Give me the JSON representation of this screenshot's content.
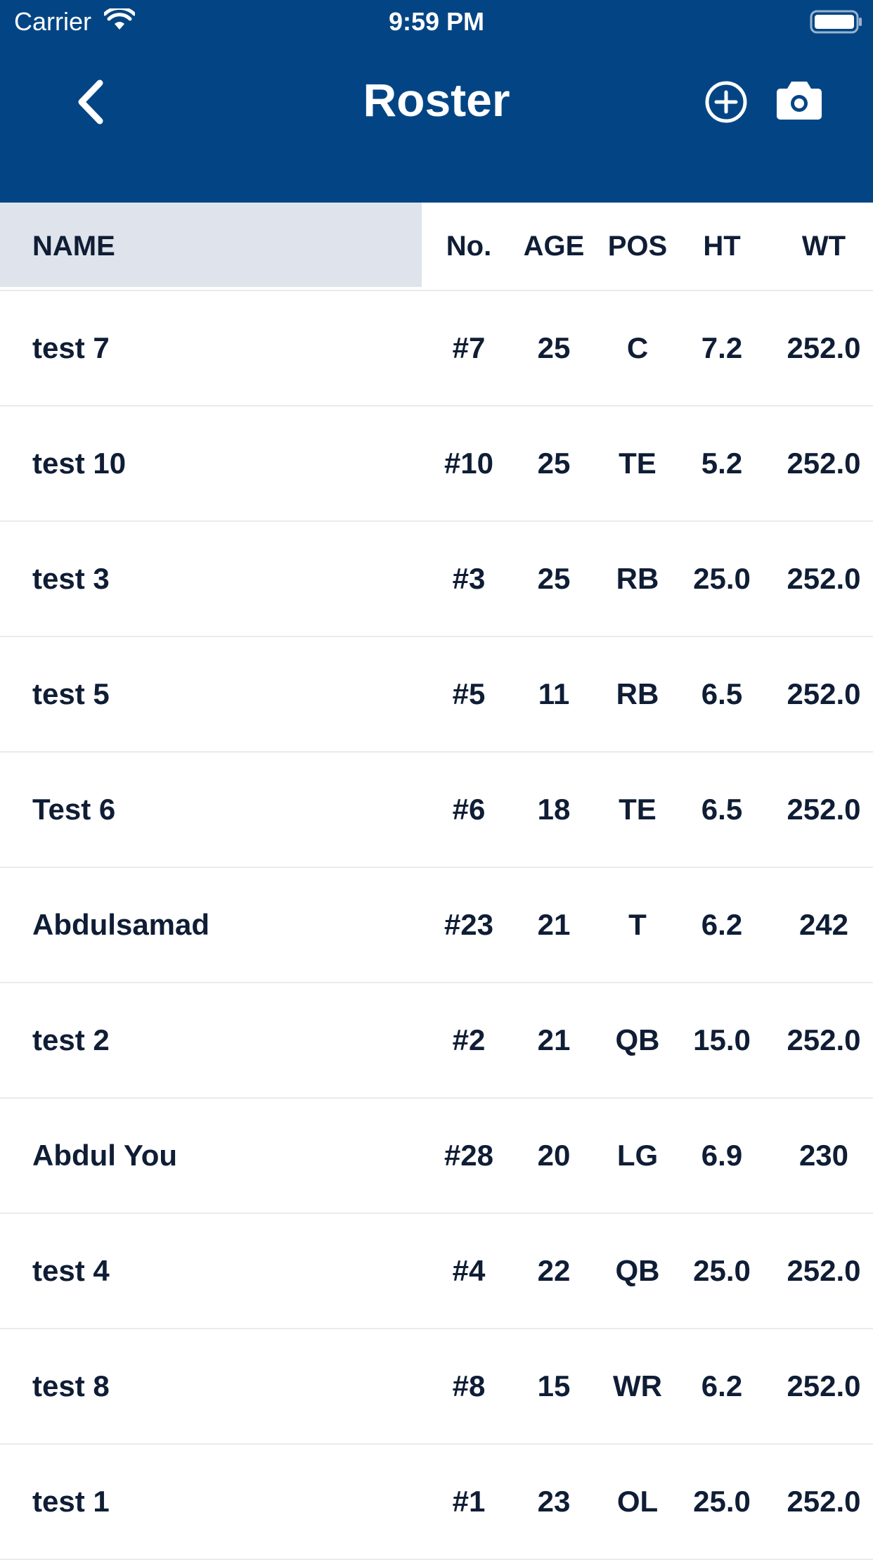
{
  "status_bar": {
    "carrier": "Carrier",
    "time": "9:59 PM"
  },
  "header": {
    "title": "Roster",
    "back_icon": "chevron-left-icon",
    "add_icon": "plus-circle-icon",
    "camera_icon": "camera-icon",
    "background_color": "#034584"
  },
  "table": {
    "columns": {
      "name": "NAME",
      "number": "No.",
      "age": "AGE",
      "position": "POS",
      "height": "HT",
      "weight": "WT"
    },
    "rows": [
      {
        "name": "test 7",
        "number": "#7",
        "age": "25",
        "position": "C",
        "height": "7.2",
        "weight": "252.0"
      },
      {
        "name": "test 10",
        "number": "#10",
        "age": "25",
        "position": "TE",
        "height": "5.2",
        "weight": "252.0"
      },
      {
        "name": "test 3",
        "number": "#3",
        "age": "25",
        "position": "RB",
        "height": "25.0",
        "weight": "252.0"
      },
      {
        "name": "test 5",
        "number": "#5",
        "age": "11",
        "position": "RB",
        "height": "6.5",
        "weight": "252.0"
      },
      {
        "name": "Test 6",
        "number": "#6",
        "age": "18",
        "position": "TE",
        "height": "6.5",
        "weight": "252.0"
      },
      {
        "name": "Abdulsamad",
        "number": "#23",
        "age": "21",
        "position": "T",
        "height": "6.2",
        "weight": "242"
      },
      {
        "name": "test 2",
        "number": "#2",
        "age": "21",
        "position": "QB",
        "height": "15.0",
        "weight": "252.0"
      },
      {
        "name": "Abdul You",
        "number": "#28",
        "age": "20",
        "position": "LG",
        "height": "6.9",
        "weight": "230"
      },
      {
        "name": "test 4",
        "number": "#4",
        "age": "22",
        "position": "QB",
        "height": "25.0",
        "weight": "252.0"
      },
      {
        "name": "test 8",
        "number": "#8",
        "age": "15",
        "position": "WR",
        "height": "6.2",
        "weight": "252.0"
      },
      {
        "name": "test 1",
        "number": "#1",
        "age": "23",
        "position": "OL",
        "height": "25.0",
        "weight": "252.0"
      }
    ]
  }
}
